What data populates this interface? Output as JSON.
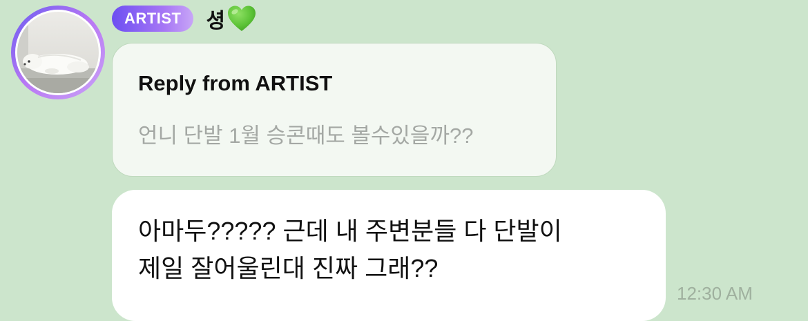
{
  "sender": {
    "badge_label": "ARTIST",
    "name": "셩",
    "emoji_icon": "green-heart-icon",
    "avatar_icon": "sleeping-dog-photo"
  },
  "reply": {
    "title": "Reply from ARTIST",
    "quoted_text": "언니 단발 1월 승콘때도 볼수있을까??"
  },
  "message": {
    "lines": [
      "아마두????? 근데 내 주변분들 다 단발이",
      "제일 잘어울린대 진짜 그래??"
    ],
    "timestamp": "12:30 AM"
  },
  "colors": {
    "background": "#cce5cc",
    "badge_gradient_start": "#6d4ff2",
    "badge_gradient_end": "#c8a6f7",
    "reply_card": "#f3f8f2",
    "bubble": "#ffffff",
    "heart": "#5bc236"
  }
}
